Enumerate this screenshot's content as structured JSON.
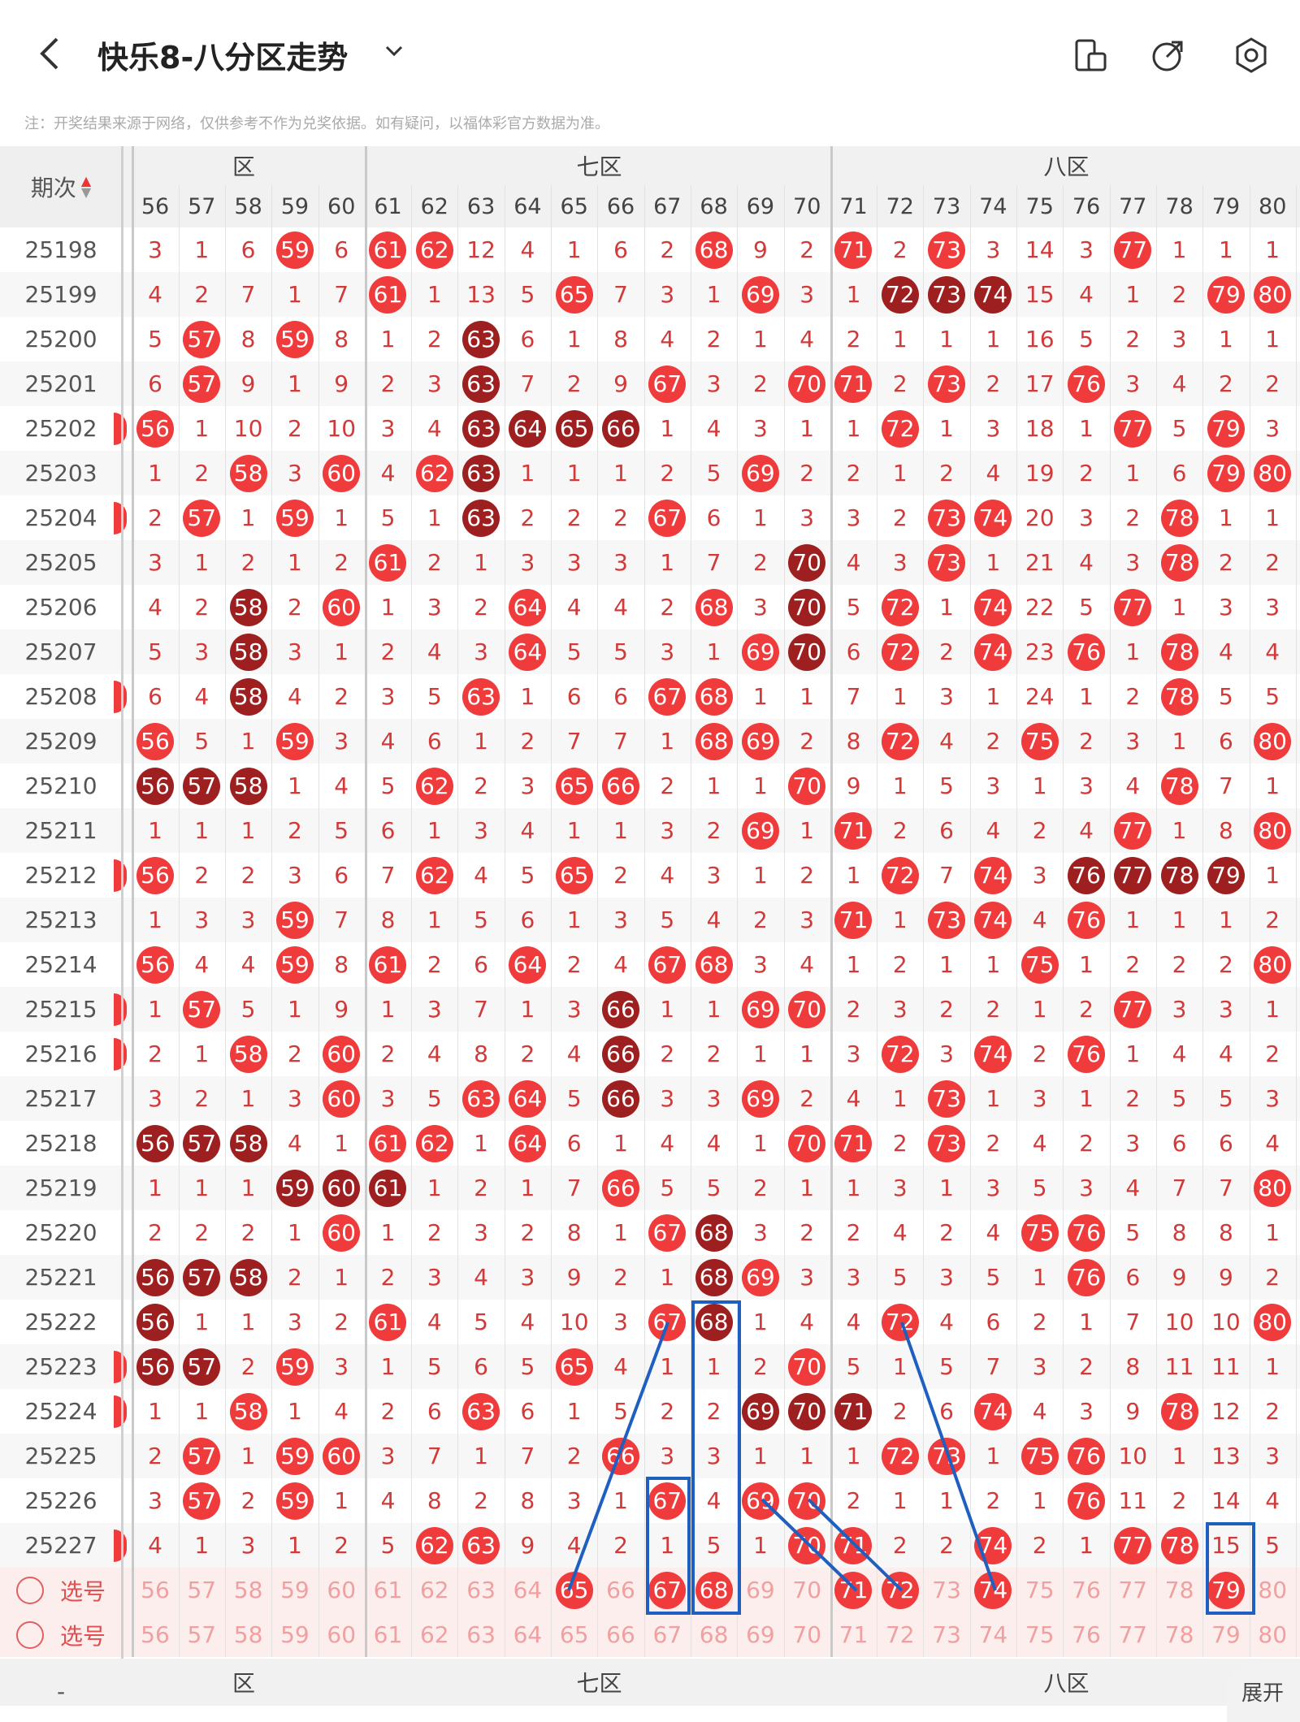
{
  "header": {
    "title": "快乐8-八分区走势",
    "notice": "注：开奖结果来源于网络，仅供参考不作为兑奖依据。如有疑问，以福体彩官方数据为准。"
  },
  "table": {
    "period_header": "期次",
    "zones": [
      {
        "label": "六区",
        "visible_label": "区"
      },
      {
        "label": "七区"
      },
      {
        "label": "八区"
      }
    ],
    "columns": [
      56,
      57,
      58,
      59,
      60,
      61,
      62,
      63,
      64,
      65,
      66,
      67,
      68,
      69,
      70,
      71,
      72,
      73,
      74,
      75,
      76,
      77,
      78,
      79,
      80
    ],
    "rows": [
      {
        "period": "25198",
        "v": [
          "3",
          "1",
          "6",
          "*59",
          "6",
          "*61",
          "*62",
          "12",
          "4",
          "1",
          "6",
          "2",
          "*68",
          "9",
          "2",
          "*71",
          "2",
          "*73",
          "3",
          "14",
          "3",
          "*77",
          "1",
          "1",
          "1"
        ]
      },
      {
        "period": "25199",
        "v": [
          "4",
          "2",
          "7",
          "1",
          "7",
          "*61",
          "1",
          "13",
          "5",
          "*65",
          "7",
          "3",
          "1",
          "*69",
          "3",
          "1",
          "#72",
          "#73",
          "#74",
          "15",
          "4",
          "1",
          "2",
          "*79",
          "*80"
        ]
      },
      {
        "period": "25200",
        "v": [
          "5",
          "*57",
          "8",
          "*59",
          "8",
          "1",
          "2",
          "#63",
          "6",
          "1",
          "8",
          "4",
          "2",
          "1",
          "4",
          "2",
          "1",
          "1",
          "1",
          "16",
          "5",
          "2",
          "3",
          "1",
          "1"
        ]
      },
      {
        "period": "25201",
        "v": [
          "6",
          "*57",
          "9",
          "1",
          "9",
          "2",
          "3",
          "#63",
          "7",
          "2",
          "9",
          "*67",
          "3",
          "2",
          "*70",
          "*71",
          "2",
          "*73",
          "2",
          "17",
          "*76",
          "3",
          "4",
          "2",
          "2"
        ]
      },
      {
        "period": "25202",
        "v": [
          "*56",
          "1",
          "10",
          "2",
          "10",
          "3",
          "4",
          "#63",
          "#64",
          "#65",
          "#66",
          "1",
          "4",
          "3",
          "1",
          "1",
          "*72",
          "1",
          "3",
          "18",
          "1",
          "*77",
          "5",
          "*79",
          "3"
        ]
      },
      {
        "period": "25203",
        "v": [
          "1",
          "2",
          "*58",
          "3",
          "*60",
          "4",
          "*62",
          "#63",
          "1",
          "1",
          "1",
          "2",
          "5",
          "*69",
          "2",
          "2",
          "1",
          "2",
          "4",
          "19",
          "2",
          "1",
          "6",
          "*79",
          "*80"
        ]
      },
      {
        "period": "25204",
        "v": [
          "2",
          "*57",
          "1",
          "*59",
          "1",
          "5",
          "1",
          "#63",
          "2",
          "2",
          "2",
          "*67",
          "6",
          "1",
          "3",
          "3",
          "2",
          "*73",
          "*74",
          "20",
          "3",
          "2",
          "*78",
          "1",
          "1"
        ]
      },
      {
        "period": "25205",
        "v": [
          "3",
          "1",
          "2",
          "1",
          "2",
          "*61",
          "2",
          "1",
          "3",
          "3",
          "3",
          "1",
          "7",
          "2",
          "#70",
          "4",
          "3",
          "*73",
          "1",
          "21",
          "4",
          "3",
          "*78",
          "2",
          "2"
        ]
      },
      {
        "period": "25206",
        "v": [
          "4",
          "2",
          "#58",
          "2",
          "*60",
          "1",
          "3",
          "2",
          "*64",
          "4",
          "4",
          "2",
          "*68",
          "3",
          "#70",
          "5",
          "*72",
          "1",
          "*74",
          "22",
          "5",
          "*77",
          "1",
          "3",
          "3"
        ]
      },
      {
        "period": "25207",
        "v": [
          "5",
          "3",
          "#58",
          "3",
          "1",
          "2",
          "4",
          "3",
          "*64",
          "5",
          "5",
          "3",
          "1",
          "*69",
          "#70",
          "6",
          "*72",
          "2",
          "*74",
          "23",
          "*76",
          "1",
          "*78",
          "4",
          "4"
        ]
      },
      {
        "period": "25208",
        "v": [
          "6",
          "4",
          "#58",
          "4",
          "2",
          "3",
          "5",
          "*63",
          "1",
          "6",
          "6",
          "*67",
          "*68",
          "1",
          "1",
          "7",
          "1",
          "3",
          "1",
          "24",
          "1",
          "2",
          "*78",
          "5",
          "5"
        ]
      },
      {
        "period": "25209",
        "v": [
          "*56",
          "5",
          "1",
          "*59",
          "3",
          "4",
          "6",
          "1",
          "2",
          "7",
          "7",
          "1",
          "*68",
          "*69",
          "2",
          "8",
          "*72",
          "4",
          "2",
          "*75",
          "2",
          "3",
          "1",
          "6",
          "*80"
        ]
      },
      {
        "period": "25210",
        "v": [
          "#56",
          "#57",
          "#58",
          "1",
          "4",
          "5",
          "*62",
          "2",
          "3",
          "*65",
          "*66",
          "2",
          "1",
          "1",
          "*70",
          "9",
          "1",
          "5",
          "3",
          "1",
          "3",
          "4",
          "*78",
          "7",
          "1"
        ]
      },
      {
        "period": "25211",
        "v": [
          "1",
          "1",
          "1",
          "2",
          "5",
          "6",
          "1",
          "3",
          "4",
          "1",
          "1",
          "3",
          "2",
          "*69",
          "1",
          "*71",
          "2",
          "6",
          "4",
          "2",
          "4",
          "*77",
          "1",
          "8",
          "*80"
        ]
      },
      {
        "period": "25212",
        "v": [
          "*56",
          "2",
          "2",
          "3",
          "6",
          "7",
          "*62",
          "4",
          "5",
          "*65",
          "2",
          "4",
          "3",
          "1",
          "2",
          "1",
          "*72",
          "7",
          "*74",
          "3",
          "#76",
          "#77",
          "#78",
          "#79",
          "1"
        ]
      },
      {
        "period": "25213",
        "v": [
          "1",
          "3",
          "3",
          "*59",
          "7",
          "8",
          "1",
          "5",
          "6",
          "1",
          "3",
          "5",
          "4",
          "2",
          "3",
          "*71",
          "1",
          "*73",
          "*74",
          "4",
          "*76",
          "1",
          "1",
          "1",
          "2"
        ]
      },
      {
        "period": "25214",
        "v": [
          "*56",
          "4",
          "4",
          "*59",
          "8",
          "*61",
          "2",
          "6",
          "*64",
          "2",
          "4",
          "*67",
          "*68",
          "3",
          "4",
          "1",
          "2",
          "1",
          "1",
          "*75",
          "1",
          "2",
          "2",
          "2",
          "*80"
        ]
      },
      {
        "period": "25215",
        "v": [
          "1",
          "*57",
          "5",
          "1",
          "9",
          "1",
          "3",
          "7",
          "1",
          "3",
          "#66",
          "1",
          "1",
          "*69",
          "*70",
          "2",
          "3",
          "2",
          "2",
          "1",
          "2",
          "*77",
          "3",
          "3",
          "1"
        ]
      },
      {
        "period": "25216",
        "v": [
          "2",
          "1",
          "*58",
          "2",
          "*60",
          "2",
          "4",
          "8",
          "2",
          "4",
          "#66",
          "2",
          "2",
          "1",
          "1",
          "3",
          "*72",
          "3",
          "*74",
          "2",
          "*76",
          "1",
          "4",
          "4",
          "2"
        ]
      },
      {
        "period": "25217",
        "v": [
          "3",
          "2",
          "1",
          "3",
          "*60",
          "3",
          "5",
          "*63",
          "*64",
          "5",
          "#66",
          "3",
          "3",
          "*69",
          "2",
          "4",
          "1",
          "*73",
          "1",
          "3",
          "1",
          "2",
          "5",
          "5",
          "3"
        ]
      },
      {
        "period": "25218",
        "v": [
          "#56",
          "#57",
          "#58",
          "4",
          "1",
          "*61",
          "*62",
          "1",
          "*64",
          "6",
          "1",
          "4",
          "4",
          "1",
          "*70",
          "*71",
          "2",
          "*73",
          "2",
          "4",
          "2",
          "3",
          "6",
          "6",
          "4"
        ]
      },
      {
        "period": "25219",
        "v": [
          "1",
          "1",
          "1",
          "#59",
          "#60",
          "#61",
          "1",
          "2",
          "1",
          "7",
          "*66",
          "5",
          "5",
          "2",
          "1",
          "1",
          "3",
          "1",
          "3",
          "5",
          "3",
          "4",
          "7",
          "7",
          "*80"
        ]
      },
      {
        "period": "25220",
        "v": [
          "2",
          "2",
          "2",
          "1",
          "*60",
          "1",
          "2",
          "3",
          "2",
          "8",
          "1",
          "*67",
          "#68",
          "3",
          "2",
          "2",
          "4",
          "2",
          "4",
          "*75",
          "*76",
          "5",
          "8",
          "8",
          "1"
        ]
      },
      {
        "period": "25221",
        "v": [
          "#56",
          "#57",
          "#58",
          "2",
          "1",
          "2",
          "3",
          "4",
          "3",
          "9",
          "2",
          "1",
          "#68",
          "*69",
          "3",
          "3",
          "5",
          "3",
          "5",
          "1",
          "*76",
          "6",
          "9",
          "9",
          "2"
        ]
      },
      {
        "period": "25222",
        "v": [
          "#56",
          "1",
          "1",
          "3",
          "2",
          "*61",
          "4",
          "5",
          "4",
          "10",
          "3",
          "*67",
          "#68",
          "1",
          "4",
          "4",
          "*72",
          "4",
          "6",
          "2",
          "1",
          "7",
          "10",
          "10",
          "*80"
        ]
      },
      {
        "period": "25223",
        "v": [
          "#56",
          "#57",
          "2",
          "*59",
          "3",
          "1",
          "5",
          "6",
          "5",
          "*65",
          "4",
          "1",
          "1",
          "2",
          "*70",
          "5",
          "1",
          "5",
          "7",
          "3",
          "2",
          "8",
          "11",
          "11",
          "1"
        ]
      },
      {
        "period": "25224",
        "v": [
          "1",
          "1",
          "*58",
          "1",
          "4",
          "2",
          "6",
          "*63",
          "6",
          "1",
          "5",
          "2",
          "2",
          "#69",
          "#70",
          "#71",
          "2",
          "6",
          "*74",
          "4",
          "3",
          "9",
          "*78",
          "12",
          "2"
        ]
      },
      {
        "period": "25225",
        "v": [
          "2",
          "*57",
          "1",
          "*59",
          "*60",
          "3",
          "7",
          "1",
          "7",
          "2",
          "*66",
          "3",
          "3",
          "1",
          "1",
          "1",
          "*72",
          "*73",
          "1",
          "*75",
          "*76",
          "10",
          "1",
          "13",
          "3"
        ]
      },
      {
        "period": "25226",
        "v": [
          "3",
          "*57",
          "2",
          "*59",
          "1",
          "4",
          "8",
          "2",
          "8",
          "3",
          "1",
          "*67",
          "4",
          "*69",
          "*70",
          "2",
          "1",
          "1",
          "2",
          "1",
          "*76",
          "11",
          "2",
          "14",
          "4"
        ]
      },
      {
        "period": "25227",
        "v": [
          "4",
          "1",
          "3",
          "1",
          "2",
          "5",
          "*62",
          "*63",
          "9",
          "4",
          "2",
          "1",
          "5",
          "1",
          "*70",
          "*71",
          "2",
          "2",
          "*74",
          "2",
          "1",
          "*77",
          "*78",
          "15",
          "5"
        ]
      },
      {
        "period": "选号",
        "v": [
          "56",
          "57",
          "58",
          "59",
          "60",
          "61",
          "62",
          "63",
          "64",
          "*65",
          "66",
          "*67",
          "*68",
          "69",
          "70",
          "*71",
          "*72",
          "73",
          "*74",
          "75",
          "76",
          "77",
          "78",
          "*79",
          "80"
        ]
      },
      {
        "period": "选号",
        "v": [
          "56",
          "57",
          "58",
          "59",
          "60",
          "61",
          "62",
          "63",
          "64",
          "65",
          "66",
          "67",
          "68",
          "69",
          "70",
          "71",
          "72",
          "73",
          "74",
          "75",
          "76",
          "77",
          "78",
          "79",
          "80"
        ]
      }
    ],
    "left_edge_balls": [
      "25202",
      "25204",
      "25208",
      "25212",
      "25215",
      "25216",
      "25223",
      "25224",
      "25227"
    ],
    "expand_label": "展开",
    "footer_dash": "-"
  },
  "colors": {
    "accent_red": "#ef3b3b",
    "dark_red": "#9e1f1f",
    "annotation_blue": "#1f5fbf"
  }
}
